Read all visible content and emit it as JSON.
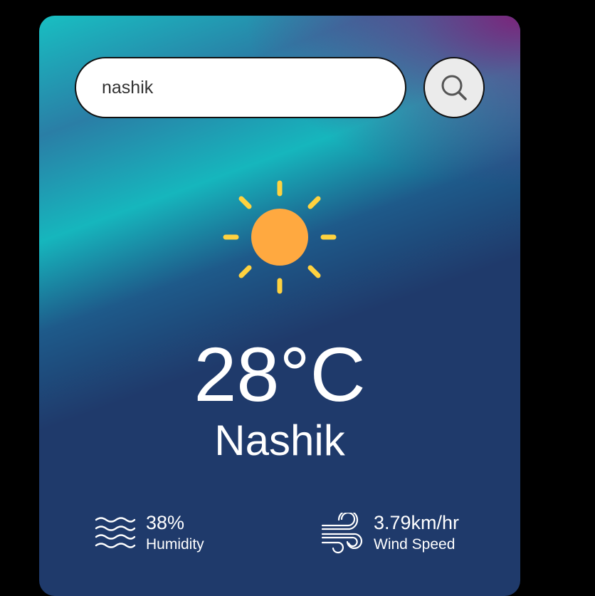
{
  "search": {
    "value": "nashik"
  },
  "weather": {
    "icon": "sun-icon",
    "temperature": "28°C",
    "city": "Nashik"
  },
  "humidity": {
    "icon": "humidity-waves-icon",
    "value": "38%",
    "label": "Humidity"
  },
  "wind": {
    "icon": "wind-icon",
    "value": "3.79km/hr",
    "label": "Wind Speed"
  },
  "colors": {
    "sun": "#FFA940",
    "sun_rays": "#FFD23F",
    "card_dark": "#1F3A6B",
    "card_teal": "#18BFC2",
    "card_purple": "#801E78"
  }
}
